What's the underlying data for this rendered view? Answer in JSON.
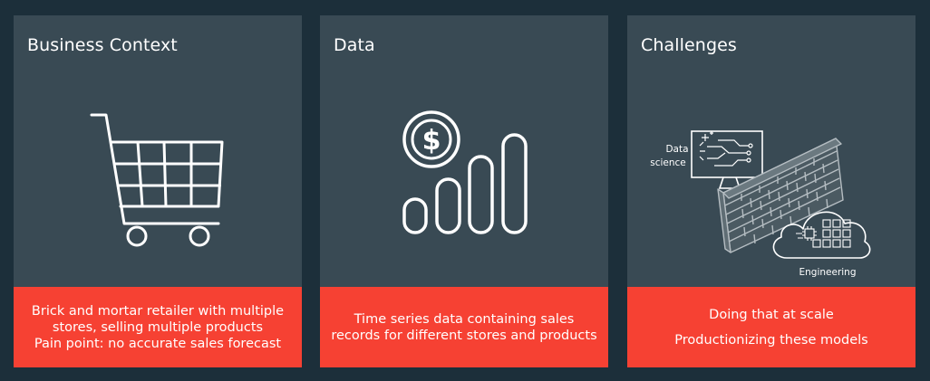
{
  "panels": [
    {
      "title": "Business Context",
      "icon": "shopping-cart-icon",
      "lines": [
        "Brick and mortar retailer with multiple stores, selling multiple products",
        "Pain point: no accurate sales forecast"
      ]
    },
    {
      "title": "Data",
      "icon": "dollar-bar-chart-icon",
      "lines": [
        "Time series data containing sales records for different stores and products"
      ]
    },
    {
      "title": "Challenges",
      "icon": "data-science-engineering-wall-icon",
      "labels": {
        "data_science_1": "Data",
        "data_science_2": "science",
        "engineering": "Engineering"
      },
      "lines": [
        "Doing that at scale",
        "Productionizing these models"
      ]
    }
  ],
  "colors": {
    "background": "#1c2f3a",
    "panel": "#394a54",
    "accent": "#f64133",
    "text": "#ffffff"
  }
}
